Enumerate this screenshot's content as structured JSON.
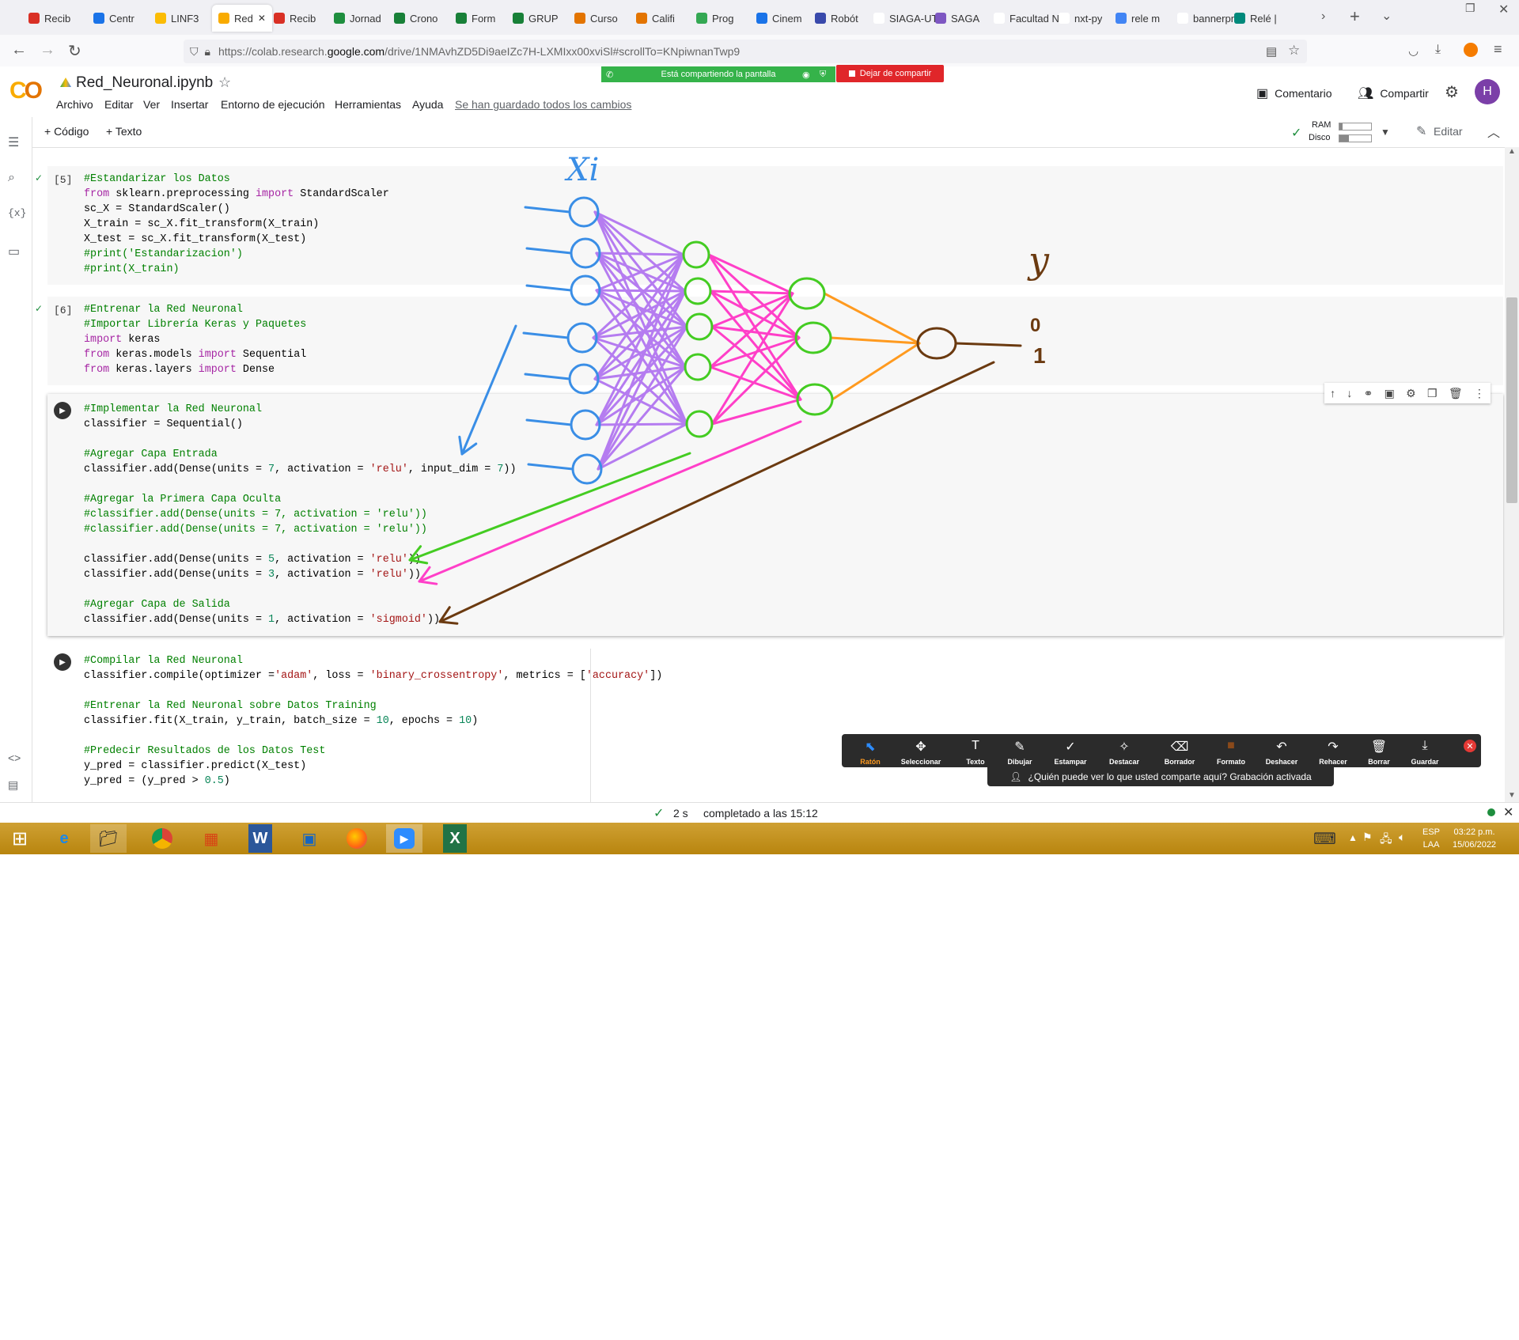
{
  "browser": {
    "tabs": [
      {
        "label": "Recib",
        "color": "#d93025"
      },
      {
        "label": "Centr",
        "color": "#1a73e8"
      },
      {
        "label": "LINF3",
        "color": "#fbbc04"
      },
      {
        "label": "Red",
        "color": "#f9ab00",
        "active": true
      },
      {
        "label": "Recib",
        "color": "#d93025"
      },
      {
        "label": "Jornad",
        "color": "#1e8e3e"
      },
      {
        "label": "Crono",
        "color": "#188038"
      },
      {
        "label": "Form",
        "color": "#188038"
      },
      {
        "label": "GRUP",
        "color": "#188038"
      },
      {
        "label": "Curso",
        "color": "#e37400"
      },
      {
        "label": "Califi",
        "color": "#e37400"
      },
      {
        "label": "Prog",
        "color": "#34a853"
      },
      {
        "label": "Cinem",
        "color": "#1a73e8"
      },
      {
        "label": "Robót",
        "color": "#3949ab"
      },
      {
        "label": "SIAGA-UT",
        "color": "#ffffff"
      },
      {
        "label": "SAGA",
        "color": "#7e57c2"
      },
      {
        "label": "Facultad N",
        "color": "#ffffff"
      },
      {
        "label": "nxt-py",
        "color": "#ffffff"
      },
      {
        "label": "rele m",
        "color": "#4285f4"
      },
      {
        "label": "bannerpn",
        "color": "#ffffff"
      },
      {
        "label": "Relé |",
        "color": "#00897b"
      }
    ],
    "url_prefix": "https://colab.research.",
    "url_domain": "google.com",
    "url_rest": "/drive/1NMAvhZD5Di9aeIZc7H-LXMIxx00xviSl#scrollTo=KNpiwnanTwp9"
  },
  "colab": {
    "title": "Red_Neuronal.ipynb",
    "menu": [
      "Archivo",
      "Editar",
      "Ver",
      "Insertar",
      "Entorno de ejecución",
      "Herramientas",
      "Ayuda"
    ],
    "saved": "Se han guardado todos los cambios",
    "sharing_banner": "Está compartiendo la pantalla",
    "stop_sharing": "Dejar de compartir",
    "comment": "Comentario",
    "share": "Compartir",
    "avatar": "H",
    "add_code": "+ Código",
    "add_text": "+ Texto",
    "ram": "RAM",
    "disk": "Disco",
    "edit": "Editar"
  },
  "cells": {
    "c5": {
      "exec": "[5]",
      "lines": [
        [
          {
            "t": "#Estandarizar los Datos",
            "c": "cm"
          }
        ],
        [
          {
            "t": "from",
            "c": "kw"
          },
          {
            "t": " sklearn.preprocessing "
          },
          {
            "t": "import",
            "c": "kw"
          },
          {
            "t": " StandardScaler"
          }
        ],
        [
          {
            "t": "sc_X = StandardScaler()"
          }
        ],
        [
          {
            "t": "X_train = sc_X.fit_transform(X_train)"
          }
        ],
        [
          {
            "t": "X_test = sc_X.fit_transform(X_test)"
          }
        ],
        [
          {
            "t": "#print('Estandarizacion')",
            "c": "cm"
          }
        ],
        [
          {
            "t": "#print(X_train)",
            "c": "cm"
          }
        ]
      ]
    },
    "c6": {
      "exec": "[6]",
      "lines": [
        [
          {
            "t": "#Entrenar la Red Neuronal",
            "c": "cm"
          }
        ],
        [
          {
            "t": "#Importar Librería Keras y Paquetes",
            "c": "cm"
          }
        ],
        [
          {
            "t": "import",
            "c": "kw"
          },
          {
            "t": " keras"
          }
        ],
        [
          {
            "t": "from",
            "c": "kw"
          },
          {
            "t": " keras.models "
          },
          {
            "t": "import",
            "c": "kw"
          },
          {
            "t": " Sequential"
          }
        ],
        [
          {
            "t": "from",
            "c": "kw"
          },
          {
            "t": " keras.layers "
          },
          {
            "t": "import",
            "c": "kw"
          },
          {
            "t": " Dense"
          }
        ]
      ]
    },
    "c7": {
      "lines": [
        [
          {
            "t": "#Implementar la Red Neuronal",
            "c": "cm"
          }
        ],
        [
          {
            "t": "classifier = Sequential()"
          }
        ],
        [
          {
            "t": ""
          }
        ],
        [
          {
            "t": "#Agregar Capa Entrada",
            "c": "cm"
          }
        ],
        [
          {
            "t": "classifier.add(Dense(units = "
          },
          {
            "t": "7",
            "c": "nu"
          },
          {
            "t": ", activation = "
          },
          {
            "t": "'relu'",
            "c": "st"
          },
          {
            "t": ", input_dim = "
          },
          {
            "t": "7",
            "c": "nu"
          },
          {
            "t": "))"
          }
        ],
        [
          {
            "t": ""
          }
        ],
        [
          {
            "t": "#Agregar la Primera Capa Oculta",
            "c": "cm"
          }
        ],
        [
          {
            "t": "#classifier.add(Dense(units = 7, activation = 'relu'))",
            "c": "cm"
          }
        ],
        [
          {
            "t": "#classifier.add(Dense(units = 7, activation = 'relu'))",
            "c": "cm"
          }
        ],
        [
          {
            "t": ""
          }
        ],
        [
          {
            "t": "classifier.add(Dense(units = "
          },
          {
            "t": "5",
            "c": "nu"
          },
          {
            "t": ", activation = "
          },
          {
            "t": "'relu'",
            "c": "st"
          },
          {
            "t": "))"
          }
        ],
        [
          {
            "t": "classifier.add(Dense(units = "
          },
          {
            "t": "3",
            "c": "nu"
          },
          {
            "t": ", activation = "
          },
          {
            "t": "'relu'",
            "c": "st"
          },
          {
            "t": "))"
          }
        ],
        [
          {
            "t": ""
          }
        ],
        [
          {
            "t": "#Agregar Capa de Salida",
            "c": "cm"
          }
        ],
        [
          {
            "t": "classifier.add(Dense(units = "
          },
          {
            "t": "1",
            "c": "nu"
          },
          {
            "t": ", activation = "
          },
          {
            "t": "'sigmoid'",
            "c": "st"
          },
          {
            "t": "))"
          }
        ]
      ]
    },
    "c8": {
      "lines": [
        [
          {
            "t": "#Compilar la Red Neuronal",
            "c": "cm"
          }
        ],
        [
          {
            "t": "classifier.compile(optimizer ="
          },
          {
            "t": "'adam'",
            "c": "st"
          },
          {
            "t": ", loss = "
          },
          {
            "t": "'binary_crossentropy'",
            "c": "st"
          },
          {
            "t": ", metrics = ["
          },
          {
            "t": "'accuracy'",
            "c": "st"
          },
          {
            "t": "])"
          }
        ],
        [
          {
            "t": ""
          }
        ],
        [
          {
            "t": "#Entrenar la Red Neuronal sobre Datos Training",
            "c": "cm"
          }
        ],
        [
          {
            "t": "classifier.fit(X_train, y_train, batch_size = "
          },
          {
            "t": "10",
            "c": "nu"
          },
          {
            "t": ", epochs = "
          },
          {
            "t": "10",
            "c": "nu"
          },
          {
            "t": ")"
          }
        ],
        [
          {
            "t": ""
          }
        ],
        [
          {
            "t": "#Predecir Resultados de los Datos Test",
            "c": "cm"
          }
        ],
        [
          {
            "t": "y_pred = classifier.predict(X_test)"
          }
        ],
        [
          {
            "t": "y_pred = (y_pred > "
          },
          {
            "t": "0.5",
            "c": "nu"
          },
          {
            "t": ")"
          }
        ]
      ]
    }
  },
  "annotations": {
    "xi": "Xi",
    "y": "y",
    "zero": "0",
    "one": "1",
    "colors": {
      "input": "#3a8ee6",
      "hidden1": "#b57cf0",
      "hidden2": "#ff3fc8",
      "hidden3": "#ff9a1f",
      "output": "#6b3a10",
      "green": "#44cc22"
    }
  },
  "zoom_toolbar": {
    "tools": [
      "Ratón",
      "Seleccionar",
      "Texto",
      "Dibujar",
      "Estampar",
      "Destacar",
      "Borrador",
      "Formato",
      "Deshacer",
      "Rehacer",
      "Borrar",
      "Guardar"
    ],
    "notice": "¿Quién puede ver lo que usted comparte aquí? Grabación activada"
  },
  "status": {
    "time": "2 s",
    "completed": "completado a las 15:12"
  },
  "taskbar": {
    "lang1": "ESP",
    "lang2": "LAA",
    "time": "03:22 p.m.",
    "date": "15/06/2022"
  }
}
